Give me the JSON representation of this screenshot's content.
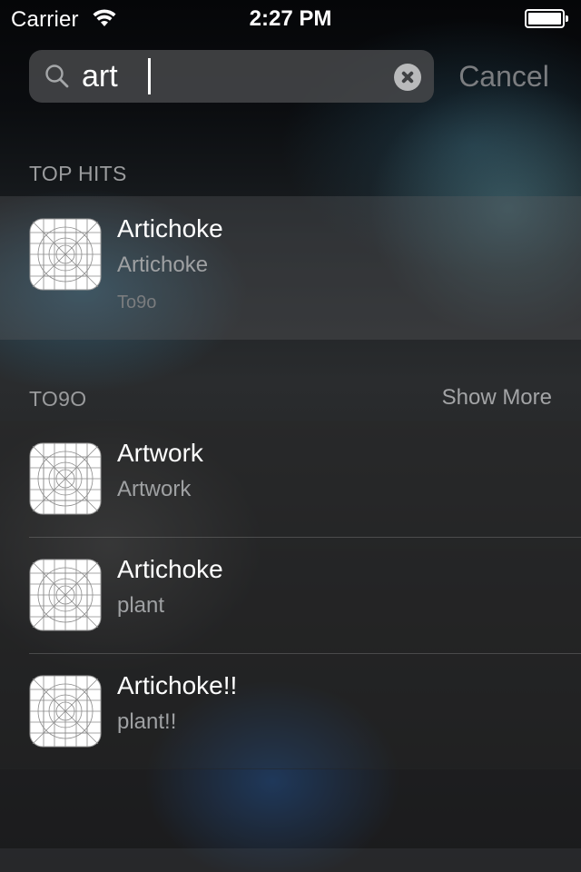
{
  "status_bar": {
    "carrier": "Carrier",
    "time": "2:27 PM",
    "battery_level": 1.0
  },
  "search": {
    "query": "art",
    "icon": "search-icon",
    "clear_icon": "clear-icon",
    "cancel_label": "Cancel"
  },
  "top_hits": {
    "header": "TOP HITS",
    "items": [
      {
        "title": "Artichoke",
        "subtitle": "Artichoke",
        "detail": "To9o",
        "icon": "app-placeholder-icon"
      }
    ]
  },
  "to9o": {
    "header": "TO9O",
    "show_more_label": "Show More",
    "items": [
      {
        "title": "Artwork",
        "subtitle": "Artwork",
        "icon": "app-placeholder-icon"
      },
      {
        "title": "Artichoke",
        "subtitle": "plant",
        "icon": "app-placeholder-icon"
      },
      {
        "title": "Artichoke!!",
        "subtitle": "plant!!",
        "icon": "app-placeholder-icon"
      }
    ]
  },
  "colors": {
    "accent_text": "#ffffff",
    "secondary_text": "#9fa1a3",
    "cancel_text": "#7b7d80"
  }
}
